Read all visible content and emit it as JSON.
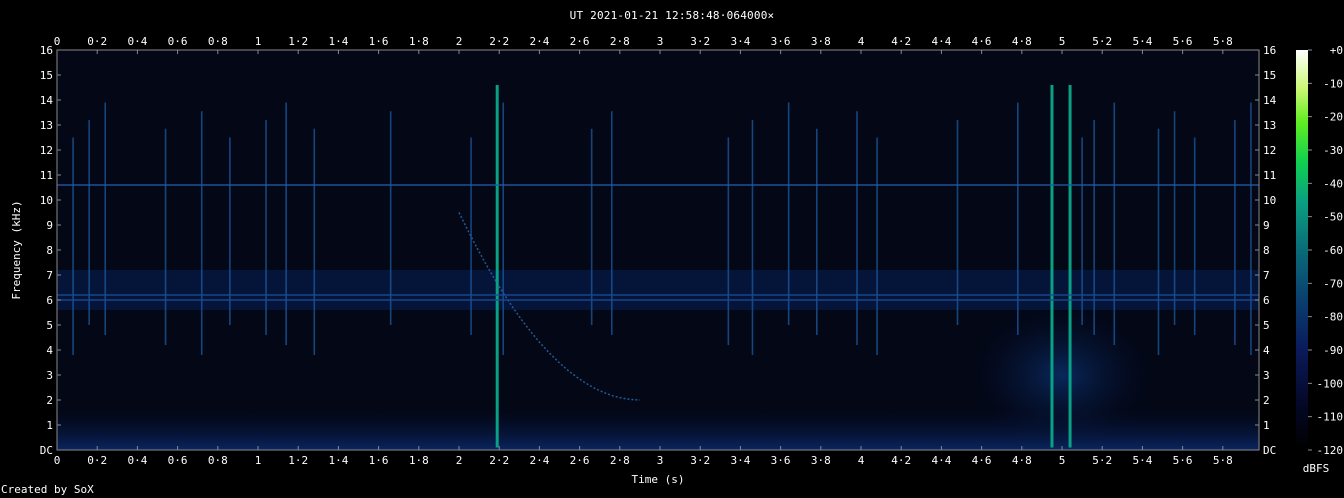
{
  "title": "UT 2021-01-21 12:58:48·064000×",
  "credit": "Created by SoX",
  "chart_data": {
    "type": "heatmap",
    "title": "UT 2021-01-21 12:58:48·064000×",
    "xlabel": "Time (s)",
    "ylabel": "Frequency (kHz)",
    "xlim": [
      0,
      5.98
    ],
    "ylim": [
      0,
      16
    ],
    "x_ticks": [
      "0",
      "0·2",
      "0·4",
      "0·6",
      "0·8",
      "1",
      "1·2",
      "1·4",
      "1·6",
      "1·8",
      "2",
      "2·2",
      "2·4",
      "2·6",
      "2·8",
      "3",
      "3·2",
      "3·4",
      "3·6",
      "3·8",
      "4",
      "4·2",
      "4·4",
      "4·6",
      "4·8",
      "5",
      "5·2",
      "5·4",
      "5·6",
      "5·8"
    ],
    "y_ticks": [
      "DC",
      "1",
      "2",
      "3",
      "4",
      "5",
      "6",
      "7",
      "8",
      "9",
      "10",
      "11",
      "12",
      "13",
      "14",
      "15",
      "16"
    ],
    "colorbar": {
      "label": "dBFS",
      "range": [
        -120,
        0
      ],
      "ticks": [
        "+0",
        "-10",
        "-20",
        "-30",
        "-40",
        "-50",
        "-60",
        "-70",
        "-80",
        "-90",
        "-100",
        "-110",
        "-120"
      ]
    },
    "features": {
      "horizontal_lines_khz": [
        10.6,
        6.2,
        6.0
      ],
      "strong_impulses_s": [
        2.19,
        4.95,
        5.04
      ],
      "impulses_s": [
        0.08,
        0.16,
        0.24,
        0.54,
        0.72,
        0.86,
        1.04,
        1.14,
        1.28,
        1.66,
        2.06,
        2.19,
        2.22,
        2.66,
        2.76,
        3.34,
        3.46,
        3.64,
        3.78,
        3.98,
        4.08,
        4.48,
        4.78,
        4.95,
        5.04,
        5.1,
        5.16,
        5.26,
        5.48,
        5.56,
        5.66,
        5.86,
        5.94
      ],
      "sweep": {
        "start_s": 2.0,
        "end_s": 2.9,
        "start_khz": 9.5,
        "end_khz": 2.0
      }
    }
  }
}
